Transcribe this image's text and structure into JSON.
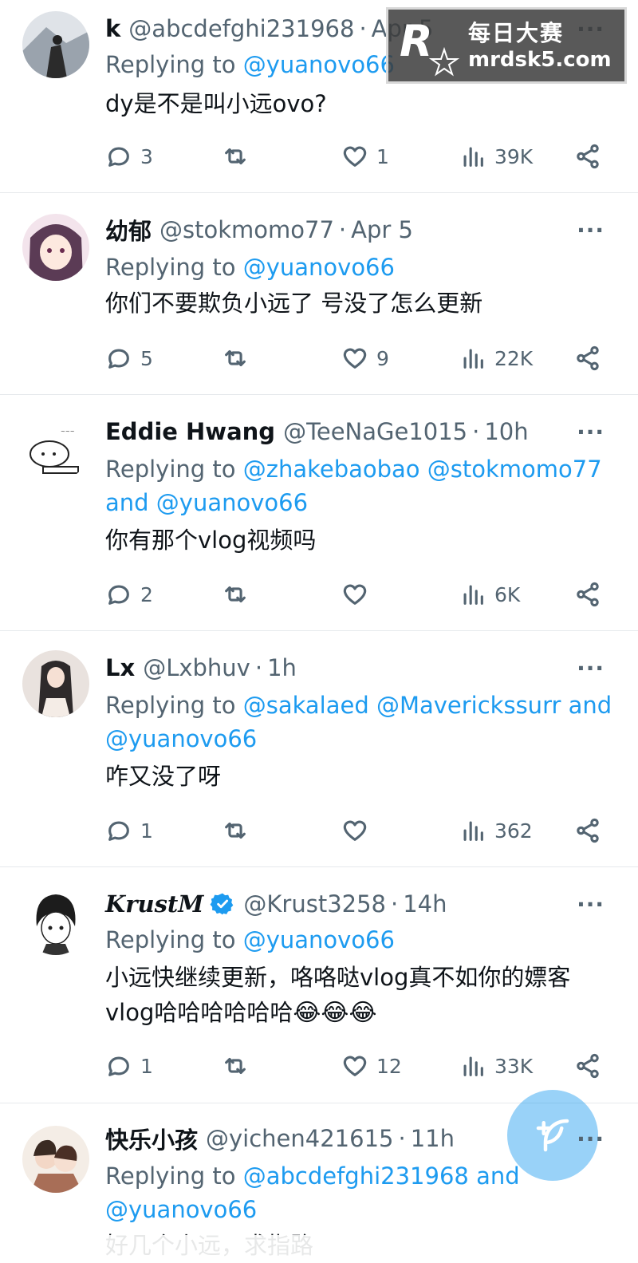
{
  "colors": {
    "accent": "#1d9bf0",
    "muted": "#536471",
    "text": "#0f1419",
    "divider": "#e6e9ec"
  },
  "watermark": {
    "brand_cn": "每日大赛",
    "url": "mrdsk5.com",
    "logo_letter": "R"
  },
  "reply_prefix": "Replying to",
  "more_glyph": "···",
  "icons": {
    "reply": "reply-icon",
    "retweet": "retweet-icon",
    "like": "like-icon",
    "views": "views-icon",
    "share": "share-icon",
    "more": "more-icon",
    "verified": "verified-badge-icon"
  },
  "tweets": [
    {
      "name": "k",
      "handle": "@abcdefghi231968",
      "time": "Apr 5",
      "mentions": [
        "@yuanovo66"
      ],
      "and_words": [],
      "body": "dy是不是叫小远ovo?",
      "replies": "3",
      "retweets": "",
      "likes": "1",
      "views": "39K"
    },
    {
      "name": "幼郁",
      "handle": "@stokmomo77",
      "time": "Apr 5",
      "mentions": [
        "@yuanovo66"
      ],
      "and_words": [],
      "body": "你们不要欺负小远了 号没了怎么更新",
      "replies": "5",
      "retweets": "",
      "likes": "9",
      "views": "22K"
    },
    {
      "name": "Eddie Hwang",
      "handle": "@TeeNaGe1015",
      "time": "10h",
      "mentions": [
        "@zhakebaobao",
        "@stokmomo77",
        "and",
        "@yuanovo66"
      ],
      "and_words": [],
      "body": "你有那个vlog视频吗",
      "replies": "2",
      "retweets": "",
      "likes": "",
      "views": "6K"
    },
    {
      "name": "Lx",
      "handle": "@Lxbhuv",
      "time": "1h",
      "mentions": [
        "@sakalaed",
        "@Maverickssurr",
        "and",
        "@yuanovo66"
      ],
      "and_words": [],
      "body": "咋又没了呀",
      "replies": "1",
      "retweets": "",
      "likes": "",
      "views": "362"
    },
    {
      "name": "KrustM",
      "handle": "@Krust3258",
      "time": "14h",
      "verified": true,
      "mentions": [
        "@yuanovo66"
      ],
      "and_words": [],
      "body_line1": "小远快继续更新，咯咯哒vlog真不如你的嫖客",
      "body_line2": "vlog哈哈哈哈哈哈",
      "body_emoji": "😂😂😂",
      "replies": "1",
      "retweets": "",
      "likes": "12",
      "views": "33K"
    },
    {
      "name": "快乐小孩",
      "handle": "@yichen421615",
      "time": "11h",
      "mentions": [
        "@abcdefghi231968",
        "and",
        "@yuanovo66"
      ],
      "and_words": [],
      "body": "好几个小远，求指路"
    }
  ]
}
